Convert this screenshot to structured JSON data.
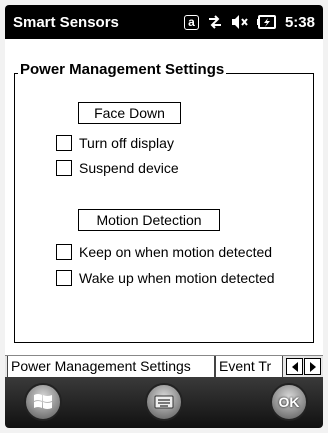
{
  "statusbar": {
    "title": "Smart Sensors",
    "time": "5:38",
    "input_indicator": "a",
    "icons": [
      "input-mode-icon",
      "sync-arrows-icon",
      "speaker-muted-icon",
      "battery-charging-icon"
    ]
  },
  "group": {
    "title": "Power Management Settings",
    "face_down": {
      "label": "Face Down",
      "options": [
        {
          "label": "Turn off display",
          "checked": false
        },
        {
          "label": "Suspend device",
          "checked": false
        }
      ]
    },
    "motion_detection": {
      "label": "Motion Detection",
      "options": [
        {
          "label": "Keep on when motion detected",
          "checked": false
        },
        {
          "label": "Wake up when motion detected",
          "checked": false
        }
      ]
    }
  },
  "tabs": {
    "items": [
      {
        "label": "Power Management Settings",
        "active": true
      },
      {
        "label": "Event Tr",
        "active": false
      }
    ]
  },
  "bottombar": {
    "ok_label": "OK"
  }
}
